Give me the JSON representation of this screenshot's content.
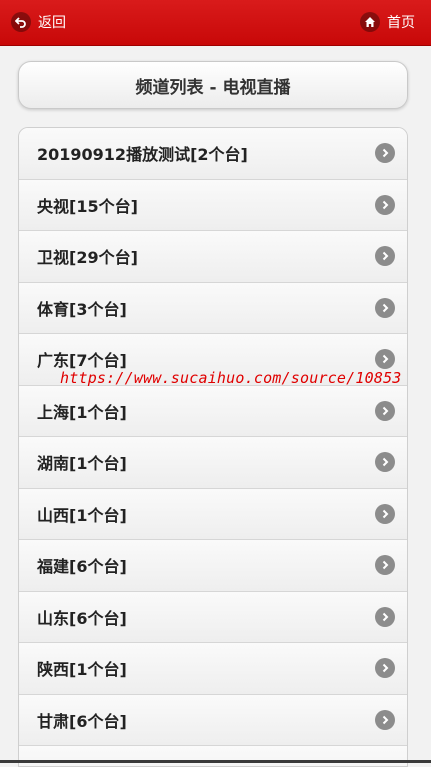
{
  "topbar": {
    "back_label": "返回",
    "home_label": "首页"
  },
  "page_title": "频道列表 - 电视直播",
  "channels": [
    {
      "label": "20190912播放测试[2个台]"
    },
    {
      "label": "央视[15个台]"
    },
    {
      "label": "卫视[29个台]"
    },
    {
      "label": "体育[3个台]"
    },
    {
      "label": "广东[7个台]"
    },
    {
      "label": "上海[1个台]"
    },
    {
      "label": "湖南[1个台]"
    },
    {
      "label": "山西[1个台]"
    },
    {
      "label": "福建[6个台]"
    },
    {
      "label": "山东[6个台]"
    },
    {
      "label": "陕西[1个台]"
    },
    {
      "label": "甘肃[6个台]"
    },
    {
      "label": ""
    }
  ],
  "watermark": "https://www.sucaihuo.com/source/10853",
  "colors": {
    "topbar": "#c80808",
    "arrow_icon": "#8c8c8c",
    "watermark": "#e00000"
  },
  "icons": {
    "back": "back-arrow-icon",
    "home": "home-icon",
    "item": "chevron-right-icon"
  }
}
